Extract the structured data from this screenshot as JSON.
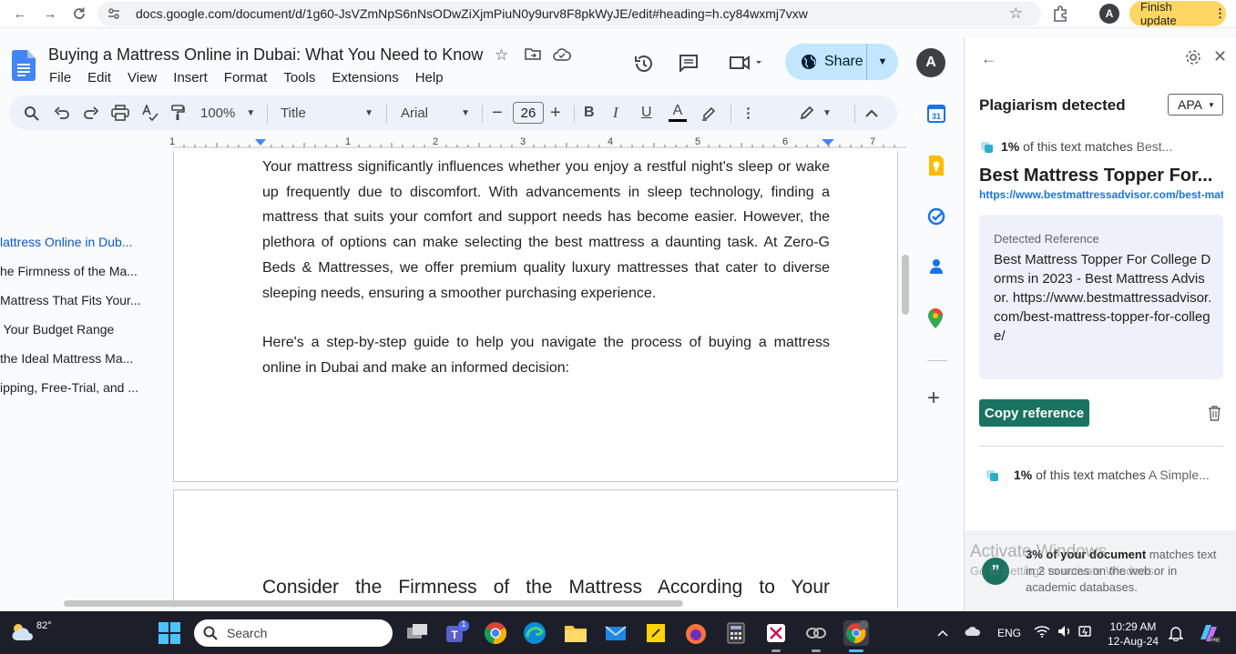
{
  "browser": {
    "url": "docs.google.com/document/d/1g60-JsVZmNpS6nNsODwZiXjmPiuN0y9urv8F8pkWyJE/edit#heading=h.cy84wxmj7vxw",
    "profile_initial": "A",
    "finish_update_label": "Finish update"
  },
  "docs": {
    "title": "Buying a Mattress Online in Dubai: What You Need to Know",
    "menu": [
      "File",
      "Edit",
      "View",
      "Insert",
      "Format",
      "Tools",
      "Extensions",
      "Help"
    ],
    "share_label": "Share",
    "avatar_initial": "A"
  },
  "toolbar": {
    "zoom": "100%",
    "style": "Title",
    "font": "Arial",
    "font_size": "26"
  },
  "ruler": {
    "ticks": [
      "1",
      "1",
      "2",
      "3",
      "4",
      "5",
      "6",
      "7"
    ]
  },
  "outline": [
    "lattress Online in Dub...",
    "he Firmness of the Ma...",
    "Mattress That Fits Your...",
    " Your Budget Range",
    "the Ideal Mattress Ma...",
    "ipping, Free-Trial, and ..."
  ],
  "document": {
    "para1": "Your mattress significantly influences whether you enjoy a restful night's sleep or wake up frequently due to discomfort. With advancements in sleep technology, finding a mattress that suits your comfort and support needs has become easier. However, the plethora of options can make selecting the best mattress a daunting task. At Zero-G Beds & Mattresses, we offer premium quality luxury mattresses that cater to diverse sleeping needs, ensuring a smoother purchasing experience.",
    "para2": "Here's a step-by-step guide to help you navigate the process of buying a mattress online in Dubai and make an informed decision:",
    "heading2": "Consider the Firmness of the Mattress According to Your"
  },
  "panel": {
    "title": "Plagiarism detected",
    "citation_style": "APA",
    "match1": {
      "percent": "1%",
      "text": "of this text matches",
      "source_short": "Best...",
      "source_title": "Best Mattress Topper For...",
      "url": "https://www.bestmattressadvisor.com/best-mattress-topper-for-college/",
      "ref_label": "Detected Reference",
      "reference": "Best Mattress Topper For College Dorms in 2023 - Best Mattress Advisor. https://www.bestmattressadvisor.com/best-mattress-topper-for-college/"
    },
    "copy_label": "Copy reference",
    "match2": {
      "percent": "1%",
      "text": "of this text matches",
      "source_short": "A Simple..."
    },
    "footer": {
      "bold": "3% of your document",
      "rest": " matches text in 2 sources on the web or in academic databases."
    }
  },
  "watermark": {
    "line1": "Activate Windows",
    "line2": "Go to Settings to activate Windows."
  },
  "taskbar": {
    "temperature": "82°",
    "search_placeholder": "Search",
    "teams_badge": "1",
    "language": "ENG",
    "time": "10:29 AM",
    "date": "12-Aug-24"
  },
  "colors": {
    "accent": "#1a7361",
    "share_bg": "#c2e7ff",
    "link": "#1a73e8",
    "update": "#fdd663"
  }
}
